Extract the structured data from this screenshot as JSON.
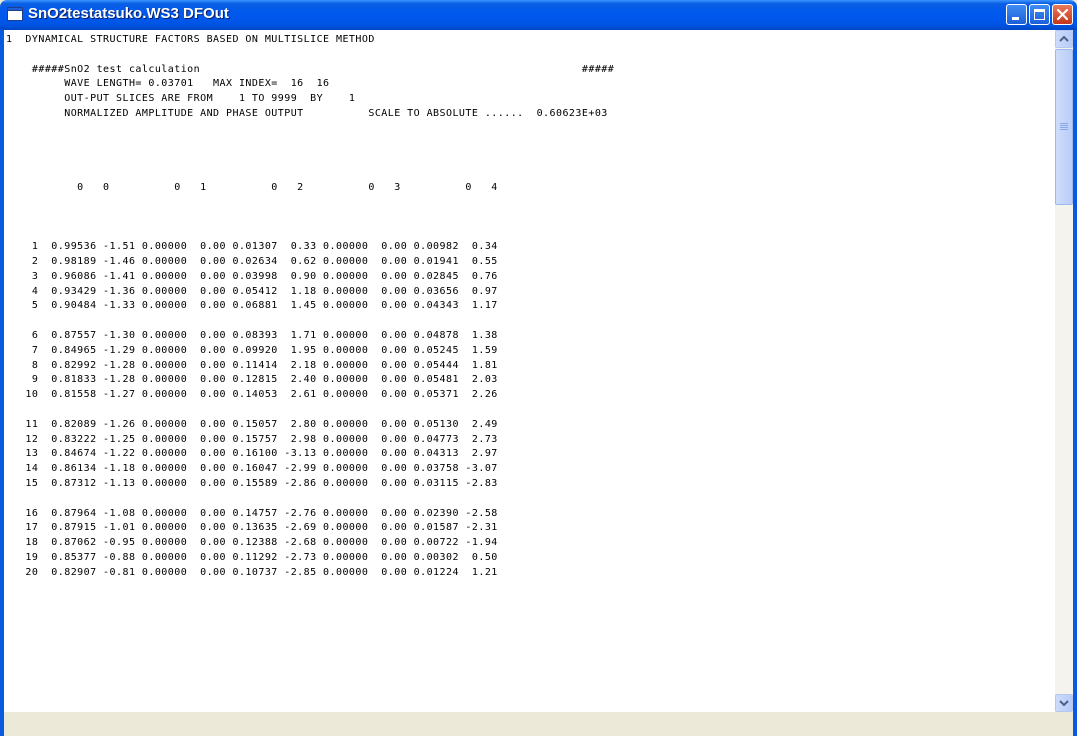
{
  "window": {
    "title": "SnO2testatsuko.WS3 DFOut"
  },
  "content": {
    "lines": [
      "1  DYNAMICAL STRUCTURE FACTORS BASED ON MULTISLICE METHOD",
      "",
      "    #####SnO2 test calculation                                                           #####",
      "         WAVE LENGTH= 0.03701   MAX INDEX=  16  16",
      "         OUT-PUT SLICES ARE FROM    1 TO 9999  BY    1",
      "         NORMALIZED AMPLITUDE AND PHASE OUTPUT          SCALE TO ABSOLUTE ......  0.60623E+03",
      "",
      "",
      "",
      "",
      "           0   0          0   1          0   2          0   3          0   4",
      "",
      "",
      "",
      "    1  0.99536 -1.51 0.00000  0.00 0.01307  0.33 0.00000  0.00 0.00982  0.34",
      "    2  0.98189 -1.46 0.00000  0.00 0.02634  0.62 0.00000  0.00 0.01941  0.55",
      "    3  0.96086 -1.41 0.00000  0.00 0.03998  0.90 0.00000  0.00 0.02845  0.76",
      "    4  0.93429 -1.36 0.00000  0.00 0.05412  1.18 0.00000  0.00 0.03656  0.97",
      "    5  0.90484 -1.33 0.00000  0.00 0.06881  1.45 0.00000  0.00 0.04343  1.17",
      "",
      "    6  0.87557 -1.30 0.00000  0.00 0.08393  1.71 0.00000  0.00 0.04878  1.38",
      "    7  0.84965 -1.29 0.00000  0.00 0.09920  1.95 0.00000  0.00 0.05245  1.59",
      "    8  0.82992 -1.28 0.00000  0.00 0.11414  2.18 0.00000  0.00 0.05444  1.81",
      "    9  0.81833 -1.28 0.00000  0.00 0.12815  2.40 0.00000  0.00 0.05481  2.03",
      "   10  0.81558 -1.27 0.00000  0.00 0.14053  2.61 0.00000  0.00 0.05371  2.26",
      "",
      "   11  0.82089 -1.26 0.00000  0.00 0.15057  2.80 0.00000  0.00 0.05130  2.49",
      "   12  0.83222 -1.25 0.00000  0.00 0.15757  2.98 0.00000  0.00 0.04773  2.73",
      "   13  0.84674 -1.22 0.00000  0.00 0.16100 -3.13 0.00000  0.00 0.04313  2.97",
      "   14  0.86134 -1.18 0.00000  0.00 0.16047 -2.99 0.00000  0.00 0.03758 -3.07",
      "   15  0.87312 -1.13 0.00000  0.00 0.15589 -2.86 0.00000  0.00 0.03115 -2.83",
      "",
      "   16  0.87964 -1.08 0.00000  0.00 0.14757 -2.76 0.00000  0.00 0.02390 -2.58",
      "   17  0.87915 -1.01 0.00000  0.00 0.13635 -2.69 0.00000  0.00 0.01587 -2.31",
      "   18  0.87062 -0.95 0.00000  0.00 0.12388 -2.68 0.00000  0.00 0.00722 -1.94",
      "   19  0.85377 -0.88 0.00000  0.00 0.11292 -2.73 0.00000  0.00 0.00302  0.50",
      "   20  0.82907 -0.81 0.00000  0.00 0.10737 -2.85 0.00000  0.00 0.01224  1.21"
    ]
  },
  "icons": {
    "app": "window-icon",
    "minimize": "minimize-icon",
    "maximize": "maximize-icon",
    "close": "close-icon",
    "scroll_up": "scroll-up-arrow-icon",
    "scroll_down": "scroll-down-arrow-icon"
  },
  "colors": {
    "titlebar": "#0055e5",
    "close_button": "#c4361a",
    "text": "#000000",
    "background": "#ffffff"
  }
}
